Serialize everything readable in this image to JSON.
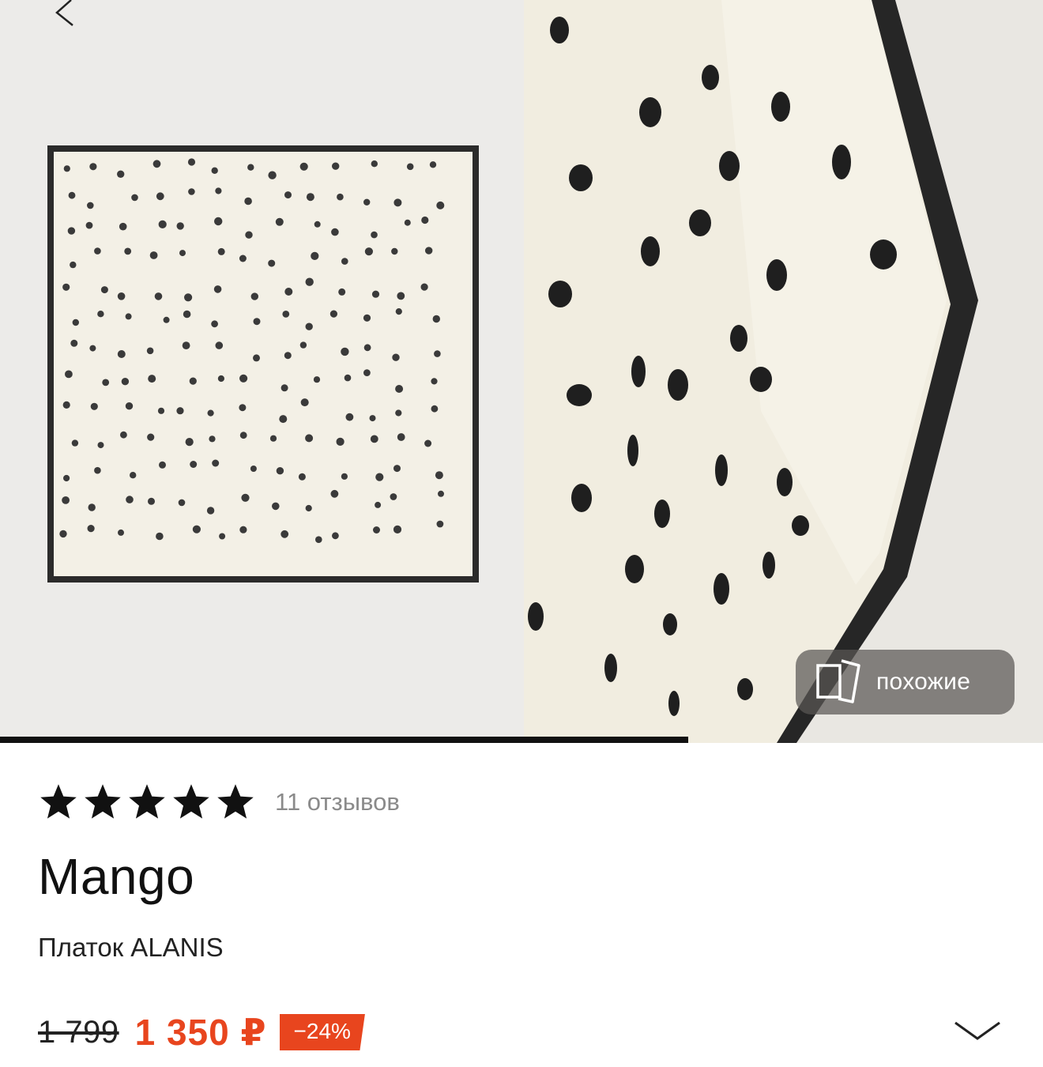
{
  "gallery": {
    "similar_label": "похожие",
    "progress": 0.66
  },
  "rating": {
    "stars": 5,
    "reviews_label": "11 отзывов"
  },
  "product": {
    "brand": "Mango",
    "name": "Платок ALANIS"
  },
  "price": {
    "old": "1 799",
    "current": "1 350 ₽",
    "discount": "−24%"
  },
  "colors": {
    "accent": "#e8451e",
    "text": "#111111",
    "muted": "#8a8a8a"
  },
  "icons": {
    "back": "chevron-left-icon",
    "similar": "cards-icon",
    "star": "star-icon",
    "expand": "chevron-down-icon"
  }
}
